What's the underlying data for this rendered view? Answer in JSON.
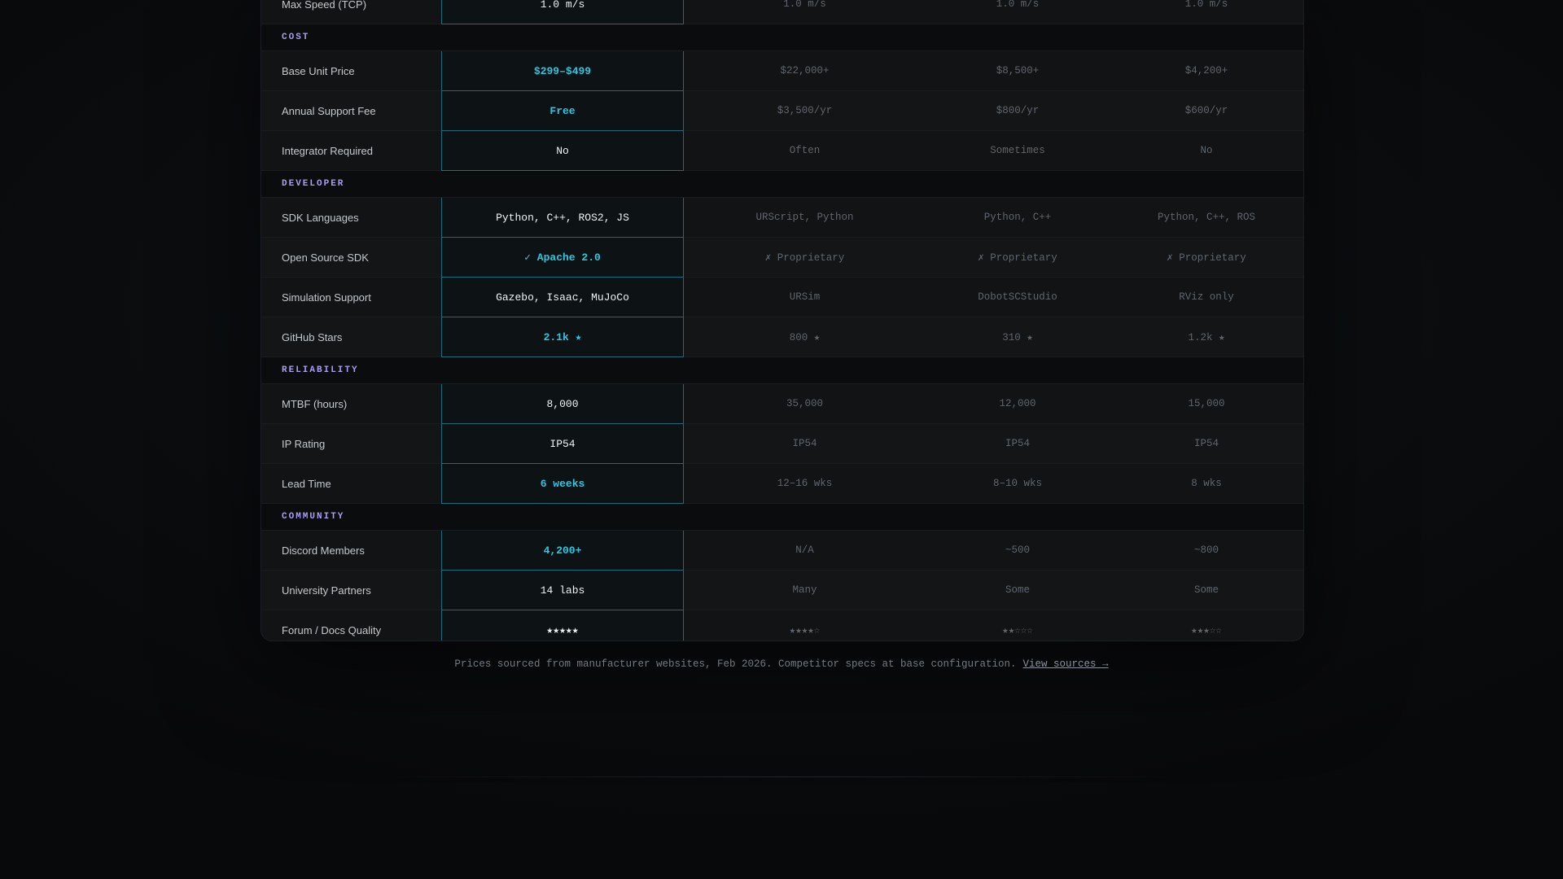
{
  "rows_top": [
    {
      "label": "Max Speed (TCP)",
      "ours": "1.0 m/s",
      "ours_hl": false,
      "c1": "1.0 m/s",
      "c2": "1.0 m/s",
      "c3": "1.0 m/s"
    }
  ],
  "sections": [
    {
      "title": "COST",
      "rows": [
        {
          "label": "Base Unit Price",
          "ours": "$299–$499",
          "ours_hl": true,
          "c1": "$22,000+",
          "c2": "$8,500+",
          "c3": "$4,200+"
        },
        {
          "label": "Annual Support Fee",
          "ours": "Free",
          "ours_hl": true,
          "c1": "$3,500/yr",
          "c2": "$800/yr",
          "c3": "$600/yr"
        },
        {
          "label": "Integrator Required",
          "ours": "No",
          "ours_hl": false,
          "c1": "Often",
          "c2": "Sometimes",
          "c3": "No"
        }
      ]
    },
    {
      "title": "DEVELOPER",
      "rows": [
        {
          "label": "SDK Languages",
          "ours": "Python, C++, ROS2, JS",
          "ours_hl": false,
          "c1": "URScript, Python",
          "c2": "Python, C++",
          "c3": "Python, C++, ROS"
        },
        {
          "label": "Open Source SDK",
          "ours": "✓ Apache 2.0",
          "ours_hl": true,
          "c1": "✗ Proprietary",
          "c2": "✗ Proprietary",
          "c3": "✗ Proprietary"
        },
        {
          "label": "Simulation Support",
          "ours": "Gazebo, Isaac, MuJoCo",
          "ours_hl": false,
          "c1": "URSim",
          "c2": "DobotSCStudio",
          "c3": "RViz only"
        },
        {
          "label": "GitHub Stars",
          "ours": "2.1k ★",
          "ours_hl": true,
          "c1": "800 ★",
          "c2": "310 ★",
          "c3": "1.2k ★"
        }
      ]
    },
    {
      "title": "RELIABILITY",
      "rows": [
        {
          "label": "MTBF (hours)",
          "ours": "8,000",
          "ours_hl": false,
          "c1": "35,000",
          "c2": "12,000",
          "c3": "15,000"
        },
        {
          "label": "IP Rating",
          "ours": "IP54",
          "ours_hl": false,
          "c1": "IP54",
          "c2": "IP54",
          "c3": "IP54"
        },
        {
          "label": "Lead Time",
          "ours": "6 weeks",
          "ours_hl": true,
          "c1": "12–16 wks",
          "c2": "8–10 wks",
          "c3": "8 wks"
        }
      ]
    },
    {
      "title": "COMMUNITY",
      "rows": [
        {
          "label": "Discord Members",
          "ours": "4,200+",
          "ours_hl": true,
          "c1": "N/A",
          "c2": "~500",
          "c3": "~800"
        },
        {
          "label": "University Partners",
          "ours": "14 labs",
          "ours_hl": false,
          "c1": "Many",
          "c2": "Some",
          "c3": "Some"
        },
        {
          "label": "Forum / Docs Quality",
          "ours": "★★★★★",
          "ours_hl": false,
          "c1": "★★★★☆",
          "c2": "★★☆☆☆",
          "c3": "★★★☆☆"
        }
      ]
    }
  ],
  "footnote": {
    "text": "Prices sourced from manufacturer websites, Feb 2026. Competitor specs at base configuration.",
    "link": "View sources →"
  },
  "colors": {
    "accent": "#2ec6e0",
    "section_label": "#a99ef0",
    "highlight_border": "#1f6b7c"
  }
}
